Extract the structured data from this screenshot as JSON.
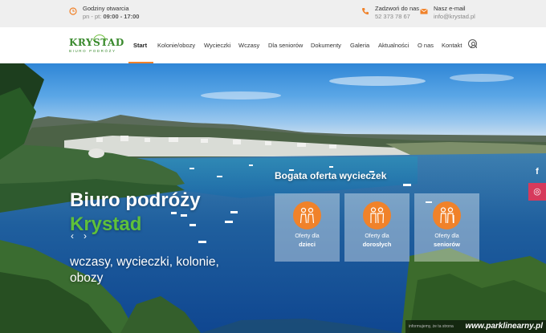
{
  "topbar": {
    "hours": {
      "title": "Godziny otwarcia",
      "days": "pn - pt:",
      "time": "09:00 - 17:00"
    },
    "phone": {
      "title": "Zadzwoń do nas",
      "value": "52 373 78 67"
    },
    "email": {
      "title": "Nasz e-mail",
      "value": "info@krystad.pl"
    }
  },
  "logo": {
    "name": "KRYSTAD",
    "tagline": "BIURO PODRÓŻY"
  },
  "nav": {
    "items": [
      {
        "label": "Start",
        "active": true
      },
      {
        "label": "Kolonie/obozy"
      },
      {
        "label": "Wycieczki"
      },
      {
        "label": "Wczasy"
      },
      {
        "label": "Dla seniorów"
      },
      {
        "label": "Dokumenty"
      },
      {
        "label": "Galeria"
      },
      {
        "label": "Aktualności"
      },
      {
        "label": "O nas"
      },
      {
        "label": "Kontakt"
      }
    ],
    "accent": "#f0822a"
  },
  "hero": {
    "title_line1": "Biuro podróży",
    "title_line2": "Krystad",
    "subtitle": "wczasy, wycieczki, kolonie, obozy",
    "offer_heading": "Bogata oferta wycieczek",
    "cards": [
      {
        "small": "Oferty dla",
        "big": "dzieci",
        "icon": "children-icon"
      },
      {
        "small": "Oferty dla",
        "big": "dorosłych",
        "icon": "adults-icon"
      },
      {
        "small": "Oferty dla",
        "big": "seniorów",
        "icon": "seniors-icon"
      }
    ],
    "brand_green": "#5fc13a"
  },
  "social": {
    "facebook": "f",
    "instagram": "◎"
  },
  "watermark": {
    "small": "informujemy, że ta strona",
    "big": "www.parklinearny.pl"
  }
}
